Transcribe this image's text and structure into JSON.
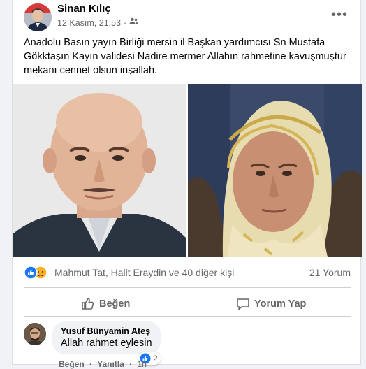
{
  "post": {
    "author": "Sinan Kılıç",
    "timestamp": "12 Kasım, 21:53",
    "separator": "·",
    "audience_icon": "friends-icon",
    "text": "Anadolu Basın yayın Birliği mersin il Başkan yardımcısı Sn Mustafa Gökktaşın Kayın validesi Nadire mermer Allahın rahmetine kavuşmuştur mekanı cennet olsun inşallah.",
    "more_icon": "•••"
  },
  "reactions": {
    "names": "Mahmut Tat, Halit Eraydin ve 40 diğer kişi",
    "comments": "21 Yorum",
    "types": [
      "like",
      "sad"
    ]
  },
  "actions": {
    "like": "Beğen",
    "comment": "Yorum Yap"
  },
  "comment": {
    "author": "Yusuf Bünyamin Ateş",
    "text": "Allah rahmet eylesin",
    "reaction_count": "2",
    "like": "Beğen",
    "reply": "Yanıtla",
    "time": "1h",
    "sep": "·"
  },
  "colors": {
    "like_blue": "#1877f2",
    "sad_yellow": "#f7b125",
    "secondary_text": "#65676b"
  }
}
